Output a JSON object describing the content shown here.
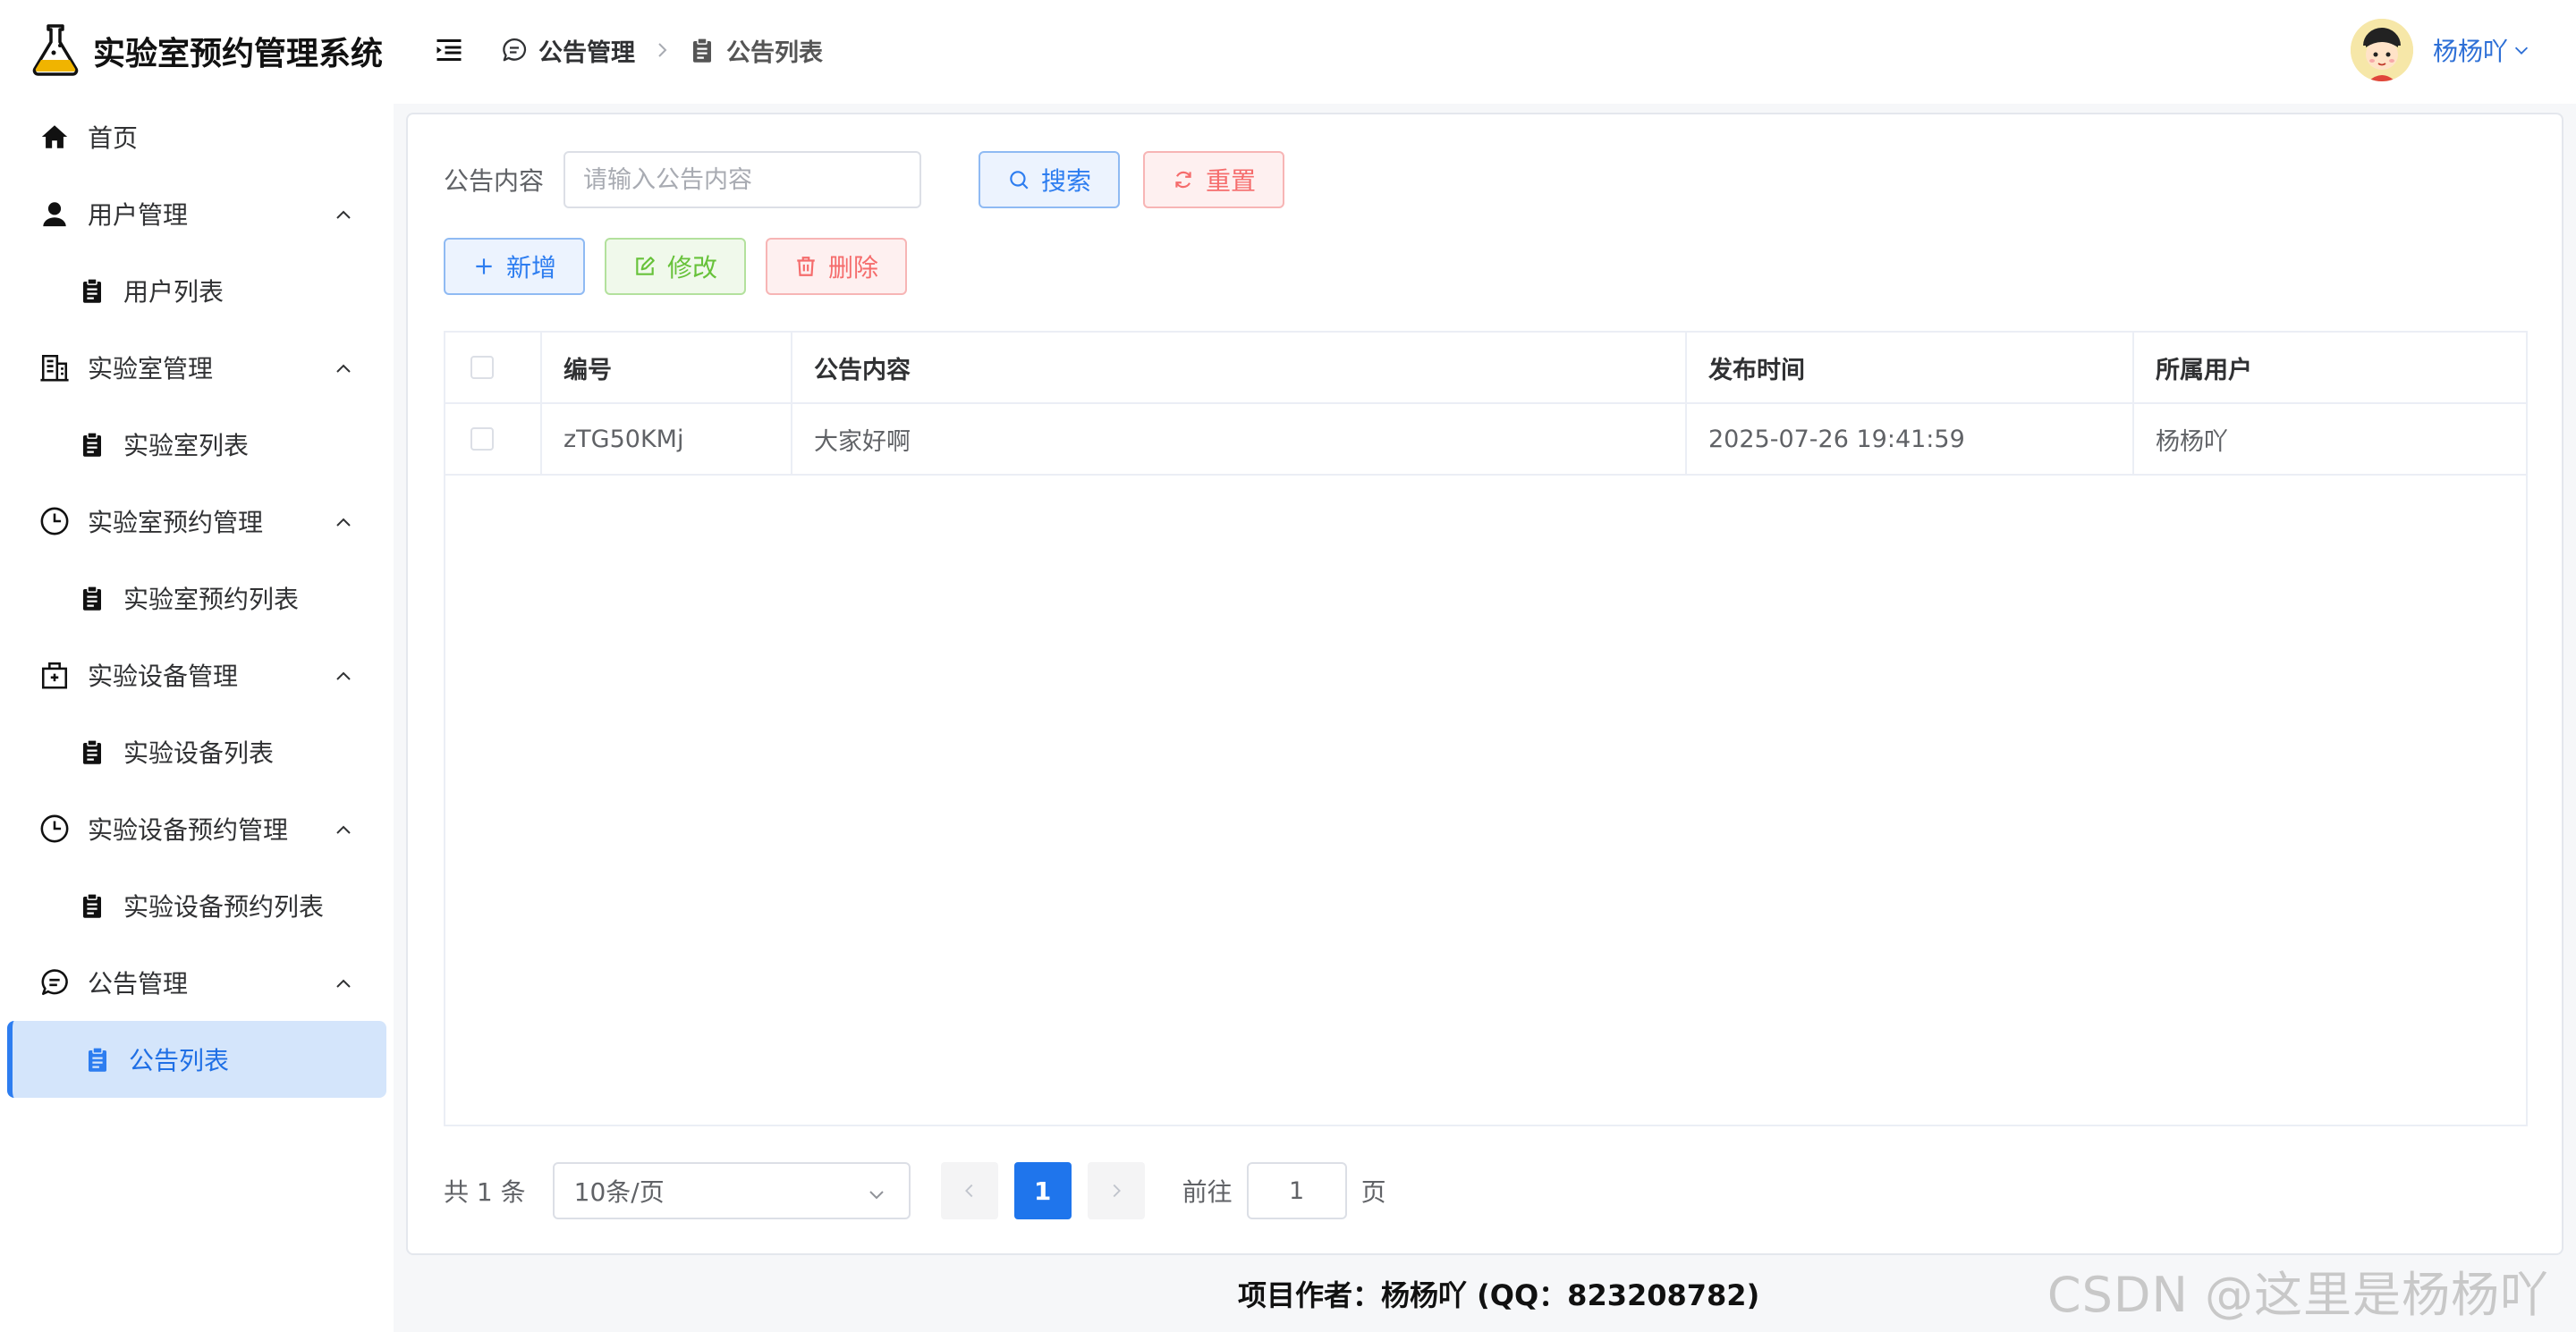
{
  "brand": {
    "title": "实验室预约管理系统",
    "logo_icon": "flask-icon"
  },
  "sidebar": {
    "items": [
      {
        "label": "首页",
        "icon": "home-icon",
        "level": 0
      },
      {
        "label": "用户管理",
        "icon": "user-icon",
        "level": 0,
        "expanded": true
      },
      {
        "label": "用户列表",
        "icon": "clipboard-icon",
        "level": 1
      },
      {
        "label": "实验室管理",
        "icon": "building-icon",
        "level": 0,
        "expanded": true
      },
      {
        "label": "实验室列表",
        "icon": "clipboard-icon",
        "level": 1
      },
      {
        "label": "实验室预约管理",
        "icon": "clock-icon",
        "level": 0,
        "expanded": true
      },
      {
        "label": "实验室预约列表",
        "icon": "clipboard-icon",
        "level": 1
      },
      {
        "label": "实验设备管理",
        "icon": "box-icon",
        "level": 0,
        "expanded": true
      },
      {
        "label": "实验设备列表",
        "icon": "clipboard-icon",
        "level": 1
      },
      {
        "label": "实验设备预约管理",
        "icon": "clock-icon",
        "level": 0,
        "expanded": true
      },
      {
        "label": "实验设备预约列表",
        "icon": "clipboard-icon",
        "level": 1
      },
      {
        "label": "公告管理",
        "icon": "chat-icon",
        "level": 0,
        "expanded": true
      },
      {
        "label": "公告列表",
        "icon": "clipboard-icon",
        "level": 1,
        "active": true
      }
    ]
  },
  "header": {
    "breadcrumb": [
      {
        "label": "公告管理",
        "icon": "chat-icon"
      },
      {
        "label": "公告列表",
        "icon": "clipboard-icon"
      }
    ],
    "user_name": "杨杨吖"
  },
  "search": {
    "label": "公告内容",
    "placeholder": "请输入公告内容",
    "value": "",
    "search_label": "搜索",
    "reset_label": "重置"
  },
  "actions": {
    "add_label": "新增",
    "edit_label": "修改",
    "delete_label": "删除"
  },
  "table": {
    "columns": [
      "编号",
      "公告内容",
      "发布时间",
      "所属用户"
    ],
    "rows": [
      {
        "id": "zTG50KMj",
        "content": "大家好啊",
        "time": "2025-07-26 19:41:59",
        "user": "杨杨吖"
      }
    ]
  },
  "pagination": {
    "total_text": "共 1 条",
    "page_size": "10条/页",
    "current_page": "1",
    "goto_label": "前往",
    "goto_value": "1",
    "page_suffix": "页"
  },
  "footer": {
    "text": "项目作者：杨杨吖 (QQ：823208782)"
  },
  "watermark": "CSDN @这里是杨杨吖",
  "colors": {
    "primary": "#2d7df0",
    "success": "#67c23a",
    "danger": "#f56c6c",
    "active_bg": "#d4e5fb"
  }
}
